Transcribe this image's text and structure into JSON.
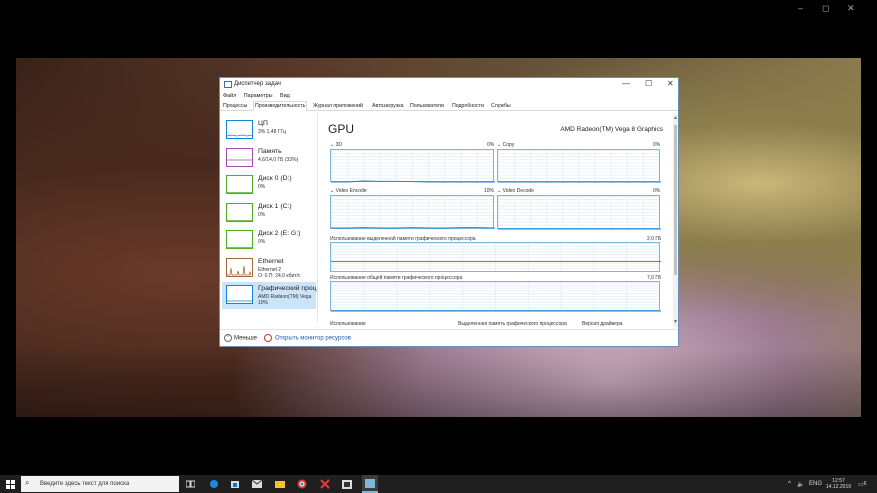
{
  "player": {
    "controls": [
      "–",
      "◻",
      "✕"
    ],
    "minimize_icon": "minimize-icon",
    "restore_icon": "restore-icon",
    "close_icon": "close-icon"
  },
  "window": {
    "title": "Диспетчер задач",
    "controls": [
      "—",
      "☐",
      "✕"
    ]
  },
  "menu": [
    "Файл",
    "Параметры",
    "Вид"
  ],
  "tabs": [
    "Процессы",
    "Производительность",
    "Журнал приложений",
    "Автозагрузка",
    "Пользователи",
    "Подробности",
    "Службы"
  ],
  "active_tab": "Производительность",
  "sidebar": [
    {
      "name": "ЦП",
      "sub": "3% 1,48 ГГц",
      "color": "#1186d4",
      "sub2": ""
    },
    {
      "name": "Память",
      "sub": "4,6/14,0 ГБ (33%)",
      "color": "#a54bb6",
      "sub2": ""
    },
    {
      "name": "Диск 0 (D:)",
      "sub": "0%",
      "color": "#4db01e",
      "sub2": ""
    },
    {
      "name": "Диск 1 (C:)",
      "sub": "0%",
      "color": "#4db01e",
      "sub2": ""
    },
    {
      "name": "Диск 2 (E: G:)",
      "sub": "0%",
      "color": "#4db01e",
      "sub2": ""
    },
    {
      "name": "Ethernet",
      "sub": "Ethernet 2",
      "sub2": "О: 0 П: 24,0 кбит/с",
      "color": "#a7673b"
    },
    {
      "name": "Графический проц",
      "sub": "AMD Radeon(TM) Vega",
      "sub2": "10%",
      "color": "#1186d4"
    }
  ],
  "gpu": {
    "title": "GPU",
    "model": "AMD Radeon(TM) Vega 8 Graphics",
    "engines": [
      {
        "name": "3D",
        "percent": "0%",
        "activity": [
          0,
          0,
          3,
          2,
          2,
          1,
          0,
          0,
          0,
          0,
          0
        ]
      },
      {
        "name": "Copy",
        "percent": "0%",
        "activity": [
          0,
          0,
          0,
          0,
          0,
          0,
          0,
          0,
          0,
          0,
          0
        ]
      },
      {
        "name": "Video Encode",
        "percent": "10%",
        "activity": [
          3,
          3,
          4,
          3,
          3,
          4,
          3,
          3,
          4,
          4,
          3
        ]
      },
      {
        "name": "Video Decode",
        "percent": "0%",
        "activity": [
          0,
          0,
          0,
          0,
          0,
          0,
          0,
          0,
          0,
          0,
          0
        ]
      }
    ],
    "dedicated_label": "Использование выделенной памяти графического процессора",
    "dedicated_max": "2,0 ГБ",
    "shared_label": "Использование общей памяти графического процессора",
    "shared_max": "7,0 ГБ",
    "bottom_labels": [
      "Использование",
      "Выделенная память графического процессора",
      "Версия драйвера"
    ]
  },
  "footer": {
    "less": "Меньше",
    "monitor": "Открыть монитор ресурсов"
  },
  "taskbar": {
    "search_placeholder": "Введите здесь текст для поиска",
    "lang": "ENG",
    "time": "12:57",
    "date": "14.12.2019",
    "notif_count": "6"
  },
  "colors": {
    "graph_border": "#7fb6d8",
    "graph_line": "#1186d4",
    "selected": "#cce4f7"
  }
}
